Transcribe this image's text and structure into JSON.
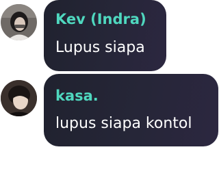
{
  "messages": [
    {
      "sender": "Kev (Indra)",
      "text": "Lupus siapa",
      "avatar": "user-avatar-photo"
    },
    {
      "sender": "kasa.",
      "text": "lupus siapa kontol",
      "avatar": "user-avatar-photo"
    }
  ],
  "colors": {
    "sender_name": "#4fd8bf",
    "bubble_background": "#262638",
    "message_text": "#ffffff",
    "page_background": "#ffffff"
  }
}
